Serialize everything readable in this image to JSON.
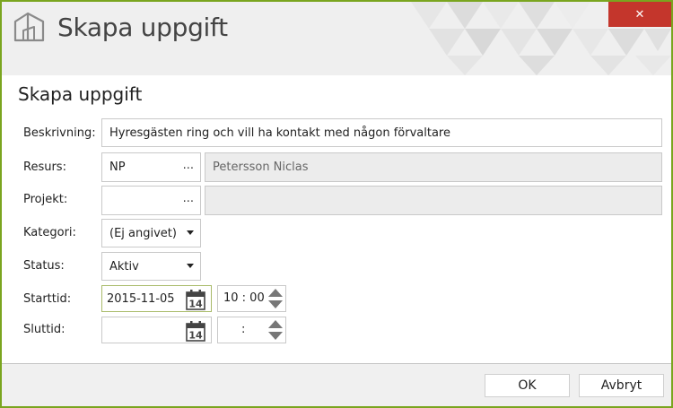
{
  "window": {
    "title": "Skapa uppgift",
    "close_glyph": "✕"
  },
  "form": {
    "title": "Skapa uppgift",
    "fields": {
      "beskrivning": {
        "label": "Beskrivning:",
        "value": "Hyresgästen ring och vill ha kontakt med någon förvaltare"
      },
      "resurs": {
        "label": "Resurs:",
        "code": "NP",
        "name": "Petersson Niclas"
      },
      "projekt": {
        "label": "Projekt:",
        "code": "",
        "name": ""
      },
      "kategori": {
        "label": "Kategori:",
        "value": "(Ej angivet)"
      },
      "status": {
        "label": "Status:",
        "value": "Aktiv"
      },
      "starttid": {
        "label": "Starttid:",
        "date": "2015-11-05",
        "time": "10 : 00"
      },
      "sluttid": {
        "label": "Sluttid:",
        "date": "",
        "time": ":"
      }
    },
    "ellipsis": "...",
    "calendar_day": "14"
  },
  "footer": {
    "ok_label": "OK",
    "cancel_label": "Avbryt"
  },
  "colors": {
    "accent_border": "#7aa51f",
    "close": "#c4362c"
  }
}
